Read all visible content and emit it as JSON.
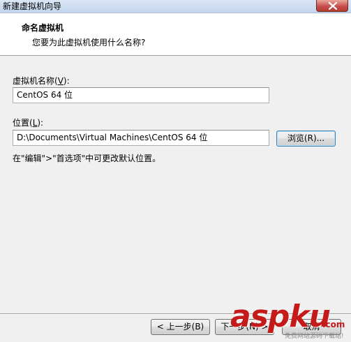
{
  "window": {
    "title": "新建虚拟机向导"
  },
  "header": {
    "title": "命名虚拟机",
    "subtitle": "您要为此虚拟机使用什么名称?"
  },
  "vm_name": {
    "label_prefix": "虚拟机名称(",
    "label_mnemonic": "V",
    "label_suffix": "):",
    "value": "CentOS 64 位"
  },
  "location": {
    "label_prefix": "位置(",
    "label_mnemonic": "L",
    "label_suffix": "):",
    "value": "D:\\Documents\\Virtual Machines\\CentOS 64 位",
    "browse_label": "浏览(R)..."
  },
  "hint": "在\"编辑\">\"首选项\"中可更改默认位置。",
  "footer": {
    "back_label": "< 上一步(B)",
    "next_label": "下一步(N) >",
    "cancel_label": "取消"
  },
  "watermark": {
    "logo_asp": "asp",
    "logo_ku": "ku",
    "logo_com": ".com",
    "subtitle": "免费网站源码下载站!"
  },
  "colors": {
    "close_button": "#c75050",
    "header_bg": "#ffffff",
    "window_bg": "#f0f0f0",
    "watermark_red": "#c41a1a"
  }
}
